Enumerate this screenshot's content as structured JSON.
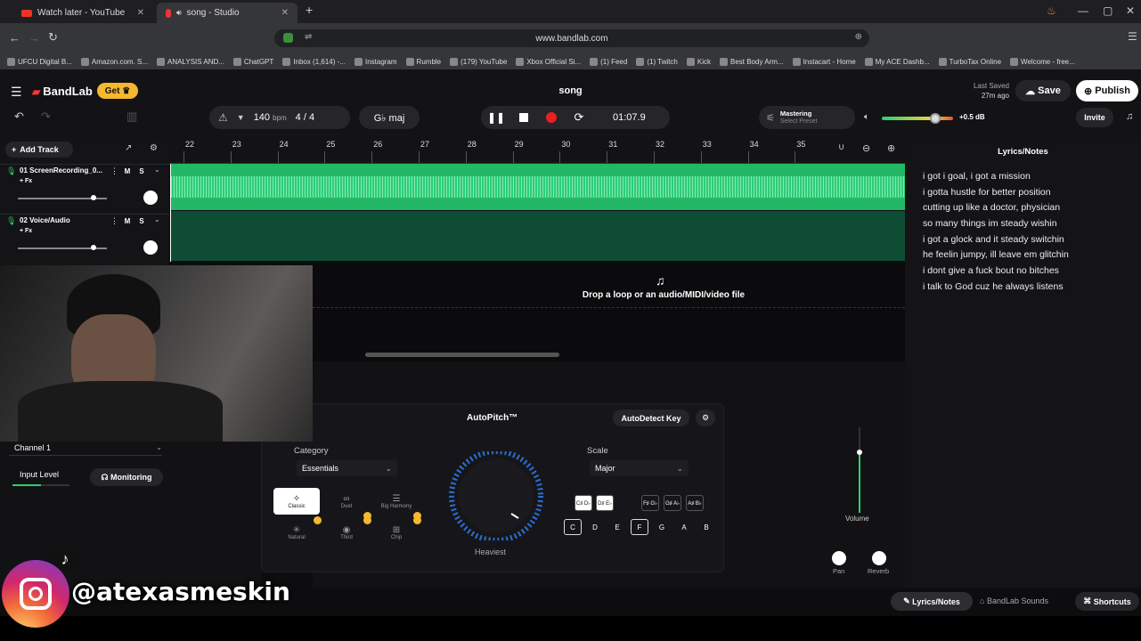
{
  "browser": {
    "tabs": [
      {
        "label": "Watch later - YouTube"
      },
      {
        "label": "song - Studio"
      }
    ],
    "url": "www.bandlab.com",
    "bookmarks": [
      "UFCU Digital B...",
      "Amazon.com. S...",
      "ANALYSIS AND...",
      "ChatGPT",
      "Inbox (1,614) -...",
      "Instagram",
      "Rumble",
      "(179) YouTube",
      "Xbox Official Si...",
      "(1) Feed",
      "(1) Twitch",
      "Kick",
      "Best Body Arm...",
      "Instacart - Home",
      "My ACE Dashb...",
      "TurboTax Online",
      "Welcome - free..."
    ]
  },
  "app": {
    "logo": "BandLab",
    "get_label": "Get",
    "project_title": "song",
    "last_saved_label": "Last Saved",
    "last_saved_time": "27m ago",
    "save_label": "Save",
    "publish_label": "Publish",
    "invite_label": "Invite",
    "tempo": "140",
    "tempo_unit": "bpm",
    "time_sig_num": "4",
    "time_sig_sep": "/",
    "time_sig_den": "4",
    "key": "G♭ maj",
    "time": "01:07.9",
    "mastering_label": "Mastering",
    "mastering_preset": "Select Preset",
    "master_gain": "+0.5 dB",
    "master_volume_level": 0.75
  },
  "timeline": {
    "bars": [
      "22",
      "23",
      "24",
      "25",
      "26",
      "27",
      "28",
      "29",
      "30",
      "31",
      "32",
      "33",
      "34",
      "35"
    ]
  },
  "tracks": {
    "add_track_label": "Add Track",
    "items": [
      {
        "number": "01",
        "name": "ScreenRecording_0...",
        "fx": "+ Fx",
        "mute": "M",
        "solo": "S",
        "volume": 0.85
      },
      {
        "number": "02",
        "name": "Voice/Audio",
        "fx": "+ Fx",
        "mute": "M",
        "solo": "S",
        "volume": 0.85
      }
    ],
    "drop_text": "Drop a loop or an audio/MIDI/video file"
  },
  "lyrics": {
    "title": "Lyrics/Notes",
    "lines": [
      "i got i goal, i got a mission",
      "i gotta hustle for better position",
      "cutting up like a doctor, physician",
      "so many things im steady wishin",
      "i got a glock and it steady switchin",
      "he feelin jumpy, ill leave em glitchin",
      "i dont give a fuck bout no bitches",
      "i talk to God cuz he always listens"
    ]
  },
  "channel": {
    "name": "Channel 1",
    "input_level_label": "Input Level",
    "monitoring_label": "Monitoring"
  },
  "autopitch": {
    "title": "AutoPitch™",
    "autodetect_label": "AutoDetect Key",
    "category_label": "Category",
    "category_value": "Essentials",
    "categories": [
      "Classic",
      "Duet",
      "Big Harmony",
      "Natural",
      "Third",
      "Chip"
    ],
    "knob_label": "Heaviest",
    "scale_label": "Scale",
    "scale_value": "Major",
    "sharps": [
      "C♯ D♭",
      "D♯ E♭",
      "F♯ G♭",
      "G♯ A♭",
      "A♯ B♭"
    ],
    "naturals": [
      "C",
      "D",
      "E",
      "F",
      "G",
      "A",
      "B"
    ],
    "volume_label": "Volume",
    "pan_label": "Pan",
    "reverb_label": "Reverb"
  },
  "bottom": {
    "lyrics_tab": "Lyrics/Notes",
    "sounds_tab": "BandLab Sounds",
    "shortcuts_tab": "Shortcuts"
  },
  "overlay": {
    "handle": "@atexasmeskin"
  }
}
